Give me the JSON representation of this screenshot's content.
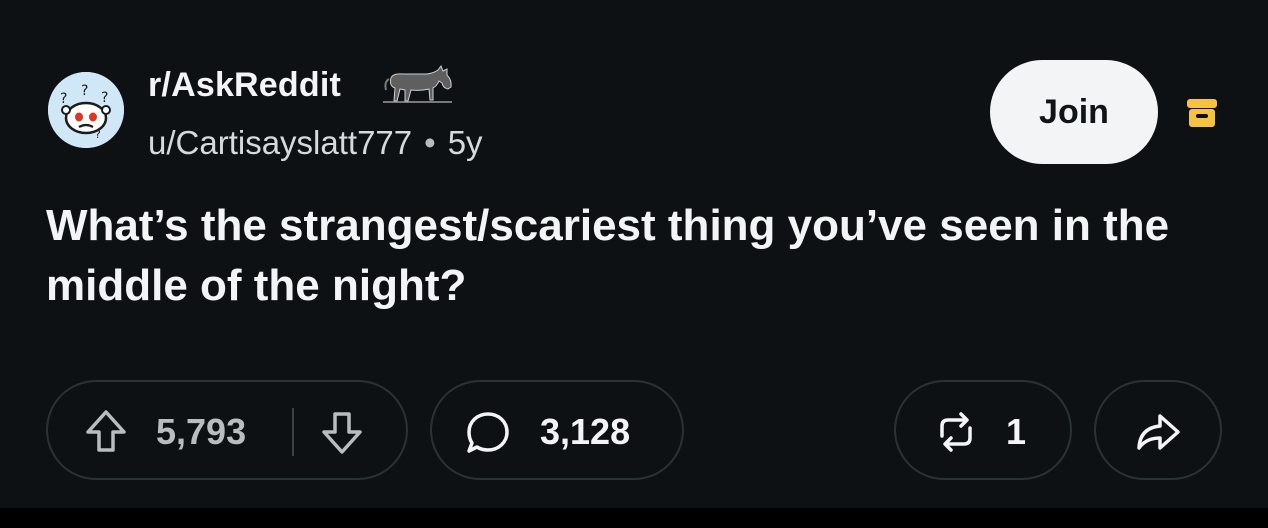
{
  "post": {
    "subreddit": "r/AskReddit",
    "username": "u/Cartisayslatt777",
    "separator": "•",
    "age": "5y",
    "title": "What’s the strangest/scariest thing you’ve seen in the middle of the night?",
    "join_label": "Join"
  },
  "actions": {
    "upvotes": "5,793",
    "comments": "3,128",
    "reposts": "1"
  },
  "icons": {
    "avatar": "askreddit-snoo-avatar",
    "flair": "donkey-flair",
    "archive": "archive-box-icon",
    "upvote": "arrow-up-icon",
    "downvote": "arrow-down-icon",
    "comment": "speech-bubble-icon",
    "repost": "repost-arrows-icon",
    "share": "share-arrow-icon"
  },
  "colors": {
    "background": "#0e1113",
    "archive_accent": "#f5c242",
    "join_background": "#f2f4f5",
    "text_primary": "#f2f4f5",
    "text_muted": "#b8bdc0"
  }
}
